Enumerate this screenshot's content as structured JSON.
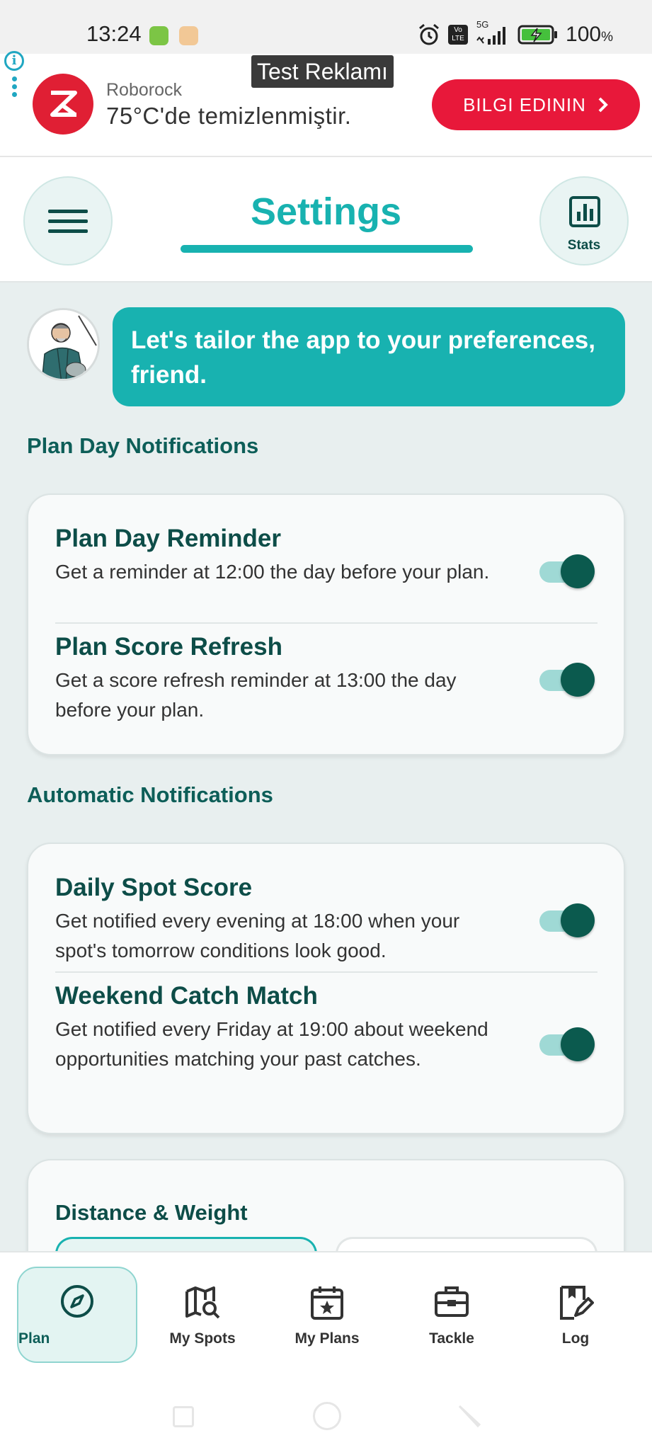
{
  "status_bar": {
    "time": "13:24",
    "network": "5G",
    "volte": "Vo LTE",
    "battery_percent": "100",
    "battery_unit": "%"
  },
  "ad": {
    "test_label": "Test Reklamı",
    "brand": "Roborock",
    "text": "75°C'de temizlenmiştir.",
    "cta": "BILGI EDININ",
    "cta_color": "#e8183a"
  },
  "header": {
    "title": "Settings",
    "stats_label": "Stats",
    "accent_color": "#18b2b0"
  },
  "intro": {
    "message": "Let's tailor the app to your preferences, friend."
  },
  "sections": {
    "plan_day": {
      "title": "Plan Day Notifications",
      "rows": [
        {
          "title": "Plan Day Reminder",
          "description": "Get a reminder at 12:00 the day before your plan.",
          "enabled": true
        },
        {
          "title": "Plan Score Refresh",
          "description": "Get a score refresh reminder at 13:00 the day before your plan.",
          "enabled": true
        }
      ]
    },
    "automatic": {
      "title": "Automatic Notifications",
      "rows": [
        {
          "title": "Daily Spot Score",
          "description": "Get notified every evening at 18:00 when your spot's tomorrow conditions look good.",
          "enabled": true
        },
        {
          "title": "Weekend Catch Match",
          "description": "Get notified every Friday at 19:00 about weekend opportunities matching your past catches.",
          "enabled": true
        }
      ]
    },
    "units": {
      "title": "Distance & Weight"
    }
  },
  "bottom_nav": {
    "items": [
      {
        "label": "Plan",
        "icon": "compass-icon",
        "active": true
      },
      {
        "label": "My Spots",
        "icon": "map-search-icon",
        "active": false
      },
      {
        "label": "My Plans",
        "icon": "calendar-star-icon",
        "active": false
      },
      {
        "label": "Tackle",
        "icon": "tackle-box-icon",
        "active": false
      },
      {
        "label": "Log",
        "icon": "logbook-edit-icon",
        "active": false
      }
    ]
  }
}
